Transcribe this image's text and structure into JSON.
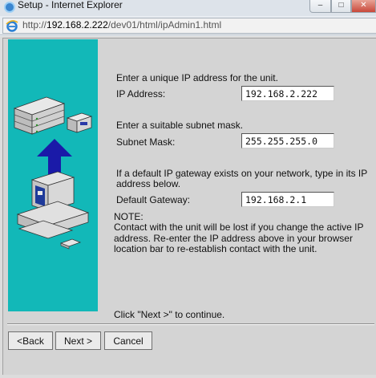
{
  "window": {
    "title": "Setup - Internet Explorer",
    "minimize_glyph": "–",
    "maximize_glyph": "□",
    "close_glyph": "✕"
  },
  "address": {
    "protocol": "http://",
    "host": "192.168.2.222",
    "path": "/dev01/html/ipAdmin1.html"
  },
  "form": {
    "ip_instruction": "Enter a unique IP address for the unit.",
    "ip_label": "IP Address:",
    "ip_value": "192.168.2.222",
    "subnet_instruction": "Enter a suitable subnet mask.",
    "subnet_label": "Subnet Mask:",
    "subnet_value": "255.255.255.0",
    "gateway_instruction_line1": "If a default IP gateway exists on your network, type in its IP",
    "gateway_instruction_line2": "address below.",
    "gateway_label": "Default Gateway:",
    "gateway_value": "192.168.2.1",
    "note_title": "NOTE:",
    "note_body": "Contact with the unit will be lost if you change the active IP address. Re-enter the IP address above in your browser location bar to re-establish contact with the unit.",
    "continue_hint": "Click \"Next >\" to continue."
  },
  "buttons": {
    "back": "<Back",
    "next": "Next >",
    "cancel": "Cancel"
  },
  "colors": {
    "side_panel": "#12b8b8",
    "arrow": "#1a1aa8"
  }
}
